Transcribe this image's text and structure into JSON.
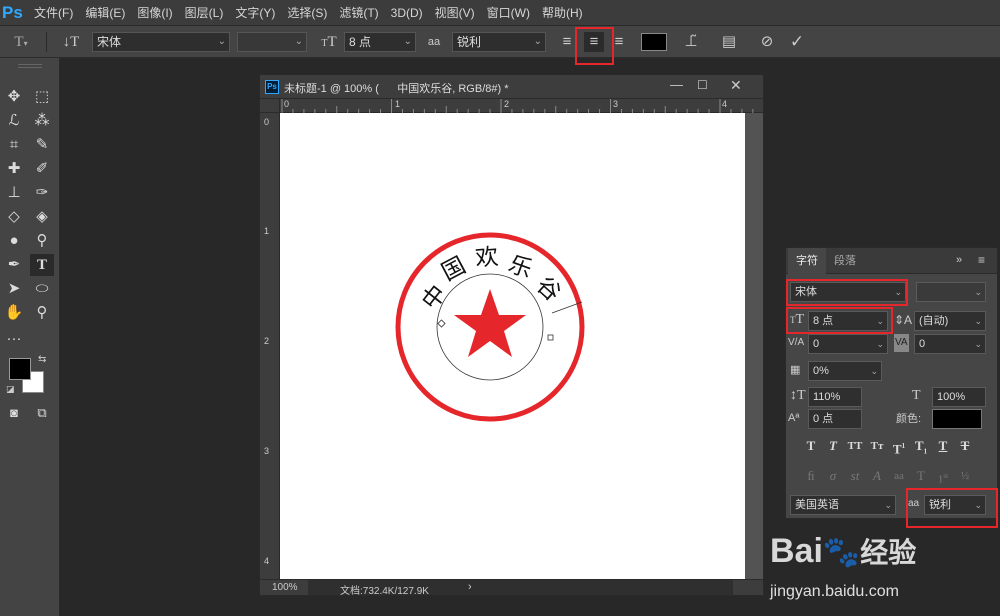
{
  "app": {
    "logo": "Ps"
  },
  "menu": [
    "文件(F)",
    "编辑(E)",
    "图像(I)",
    "图层(L)",
    "文字(Y)",
    "选择(S)",
    "滤镜(T)",
    "3D(D)",
    "视图(V)",
    "窗口(W)",
    "帮助(H)"
  ],
  "options": {
    "font_family": "宋体",
    "font_style": "",
    "font_size": "8 点",
    "aa_label": "aa",
    "antialias": "锐利",
    "color": "#000000",
    "highlighted_button": "center-align"
  },
  "document": {
    "title": "未标题-1 @ 100% (      中国欢乐谷, RGB/8#) *",
    "ruler_h": [
      "0",
      "1",
      "2",
      "3",
      "4"
    ],
    "ruler_v": [
      "0",
      "1",
      "2",
      "3",
      "4"
    ],
    "zoom": "100%",
    "doc_size": "文档:732.4K/127.9K",
    "stamp_text": [
      "中",
      "国",
      "欢",
      "乐",
      "谷"
    ],
    "stamp_color": "#e5262a"
  },
  "char_panel": {
    "tabs": [
      "字符",
      "段落"
    ],
    "font_family": "宋体",
    "font_style": "",
    "font_size": "8 点",
    "leading": "(自动)",
    "kerning": "0",
    "tracking": "0",
    "tsume": "0%",
    "vscale": "110%",
    "hscale": "100%",
    "baseline": "0 点",
    "color_label": "颜色:",
    "color": "#000000",
    "language": "美国英语",
    "aa_label": "aa",
    "antialias": "锐利"
  },
  "watermark": {
    "brand": "Bai",
    "brand2": "经验",
    "url": "jingyan.baidu.com"
  }
}
